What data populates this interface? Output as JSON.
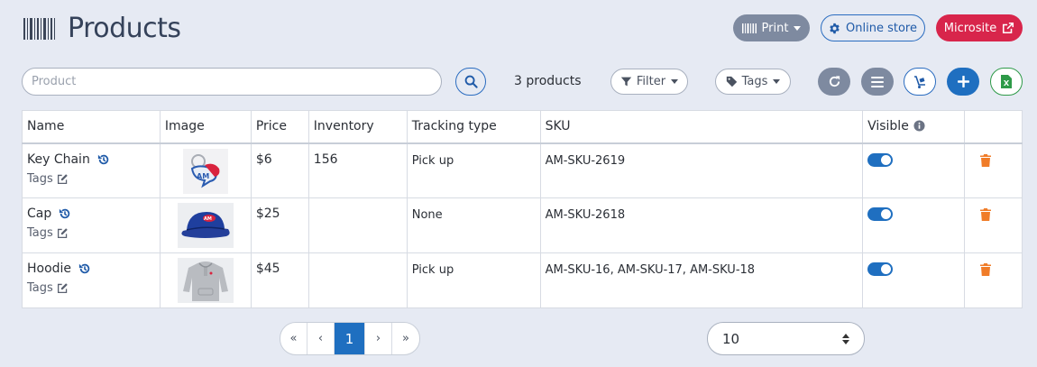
{
  "header": {
    "title": "Products",
    "print_label": "Print",
    "online_store_label": "Online store",
    "microsite_label": "Microsite"
  },
  "toolbar": {
    "search_placeholder": "Product",
    "count_text": "3 products",
    "filter_label": "Filter",
    "tags_label": "Tags"
  },
  "table": {
    "columns": [
      "Name",
      "Image",
      "Price",
      "Inventory",
      "Tracking type",
      "SKU",
      "Visible",
      ""
    ],
    "rows": [
      {
        "name": "Key Chain",
        "tags_label": "Tags",
        "image": "keychain-image",
        "price": "$6",
        "inventory": "156",
        "tracking": "Pick up",
        "sku": "AM-SKU-2619",
        "visible": true
      },
      {
        "name": "Cap",
        "tags_label": "Tags",
        "image": "cap-image",
        "price": "$25",
        "inventory": "",
        "tracking": "None",
        "sku": "AM-SKU-2618",
        "visible": true
      },
      {
        "name": "Hoodie",
        "tags_label": "Tags",
        "image": "hoodie-image",
        "price": "$45",
        "inventory": "",
        "tracking": "Pick up",
        "sku": "AM-SKU-16, AM-SKU-17, AM-SKU-18",
        "visible": true
      }
    ]
  },
  "pagination": {
    "first": "«",
    "prev": "‹",
    "current": "1",
    "next": "›",
    "last": "»"
  },
  "per_page": {
    "selected": "10"
  },
  "colors": {
    "primary": "#1f6fc0",
    "danger": "#d8254b",
    "muted": "#7e8aa0",
    "trash": "#f07c28",
    "excel": "#2e9a48"
  }
}
